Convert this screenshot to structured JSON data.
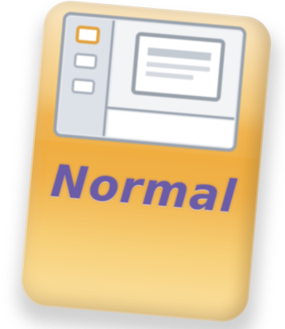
{
  "view_button": {
    "label": "Normal",
    "icon": "normal-view-icon",
    "colors": {
      "tile_top": "#f6d38d",
      "tile_mid": "#efaa38",
      "tile_bottom": "#fbe2a3",
      "label": "#6b5ca8",
      "slide_pane_selected_border": "#e2a13c"
    }
  }
}
